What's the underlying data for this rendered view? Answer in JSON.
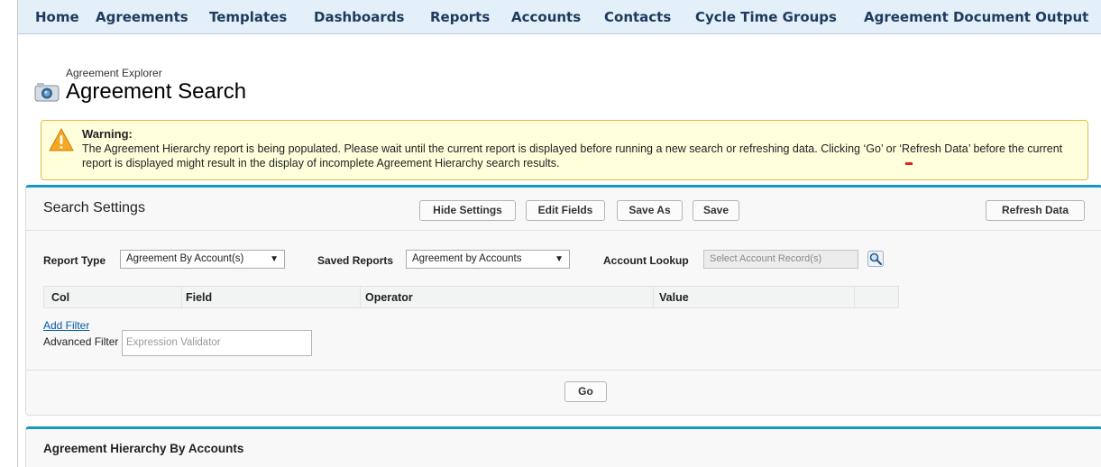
{
  "nav": {
    "tabs": [
      "Home",
      "Agreements",
      "Templates",
      "Dashboards",
      "Reports",
      "Accounts",
      "Contacts",
      "Cycle Time Groups",
      "Agreement Document Output"
    ]
  },
  "header": {
    "breadcrumb": "Agreement Explorer",
    "title": "Agreement Search",
    "icon": "agreement-explorer-icon"
  },
  "warning": {
    "title": "Warning:",
    "message": "The Agreement Hierarchy report is being populated. Please wait until the current report is displayed before running a new search or refreshing data. Clicking ‘Go’ or ‘Refresh Data’ before the current report is displayed might result in the display of incomplete Agreement Hierarchy search results.",
    "icon": "warning-icon",
    "color": "#e8b64a"
  },
  "search_settings": {
    "title": "Search Settings",
    "hide_settings_label": "Hide Settings",
    "edit_fields_label": "Edit Fields",
    "save_as_label": "Save As",
    "save_label": "Save",
    "refresh_data_label": "Refresh Data",
    "report_type_label": "Report Type",
    "report_type_value": "Agreement By Account(s)",
    "saved_reports_label": "Saved Reports",
    "saved_reports_value": "Agreement by Accounts",
    "account_lookup_label": "Account Lookup",
    "account_lookup_placeholder": "Select Account Record(s)",
    "columns": [
      "Col",
      "Field",
      "Operator",
      "Value"
    ],
    "add_filter_label": "Add Filter",
    "advanced_filter_label": "Advanced Filter",
    "advanced_filter_placeholder": "Expression Validator",
    "go_label": "Go",
    "accent_color": "#1798c1"
  },
  "results": {
    "title": "Agreement Hierarchy By Accounts"
  }
}
